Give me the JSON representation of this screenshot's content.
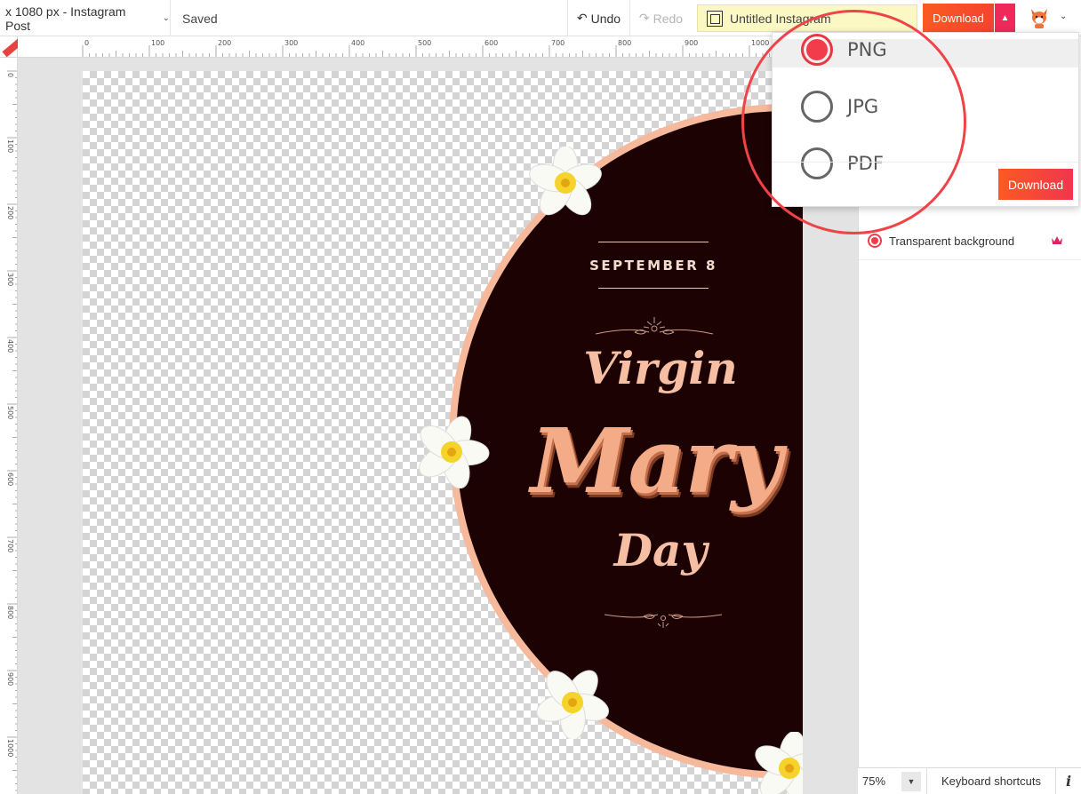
{
  "topbar": {
    "size_label": "x 1080 px - Instagram Post",
    "saved_label": "Saved",
    "undo_label": "Undo",
    "redo_label": "Redo",
    "title_label": "Untitled Instagram",
    "download_label": "Download"
  },
  "ruler": {
    "top_labels": [
      "0",
      "100",
      "200",
      "300",
      "400",
      "500",
      "600",
      "700",
      "800",
      "900",
      "1000"
    ],
    "left_labels": [
      "0",
      "100",
      "200",
      "300",
      "400",
      "500",
      "600",
      "700",
      "800",
      "900",
      "1000"
    ]
  },
  "design": {
    "date": "SEPTEMBER 8",
    "line1": "Virgin",
    "line2": "Mary",
    "line3": "Day"
  },
  "download_menu": {
    "options": [
      "PNG",
      "JPG",
      "PDF"
    ],
    "selected": "PNG",
    "button_label": "Download"
  },
  "right_panel": {
    "transparent_label": "Transparent background"
  },
  "bottombar": {
    "zoom": "75%",
    "shortcuts_label": "Keyboard shortcuts",
    "info_label": "i"
  },
  "colors": {
    "accent": "#f23b4b",
    "download": "#fb5a22",
    "disc": "#1c0203",
    "disc_border": "#f6b99c",
    "title_text": "#f6bfa3"
  }
}
